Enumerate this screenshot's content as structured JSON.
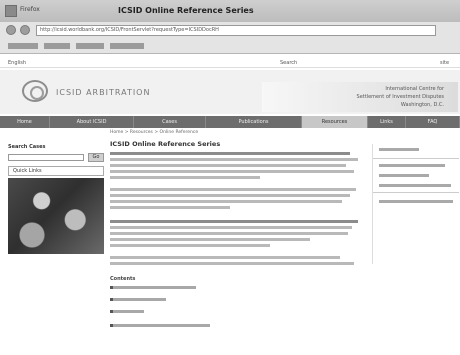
{
  "browser": {
    "window_title": "ICSID Online Reference Series",
    "app_name": "Firefox",
    "url": "http://icsid.worldbank.org/ICSID/FrontServlet?requestType=ICSIDDocRH",
    "bookmark_count": 4
  },
  "page": {
    "top_left": "English",
    "top_right": "Search",
    "top_far": "site",
    "logo_text": "ICSID ARBITRATION",
    "banner_lines": [
      "International Centre for",
      "Settlement of Investment Disputes",
      "Washington, D.C."
    ]
  },
  "navbar": {
    "items": [
      "Home",
      "About ICSID",
      "Cases",
      "Publications",
      "Resources",
      "Links",
      "FAQ"
    ],
    "active_index": 4
  },
  "sidebar": {
    "label": "Search Cases",
    "button": "Go",
    "box_label": "Quick Links"
  },
  "main": {
    "breadcrumb": "Home > Resources > Online Reference",
    "title": "ICSID Online Reference Series",
    "subhead": "Contents"
  },
  "rightbar": {
    "item_count": 5
  },
  "icons": {
    "app": "browser-app-icon",
    "back": "back-arrow-icon",
    "forward": "forward-arrow-icon",
    "logo": "icsid-logo-icon"
  },
  "colors": {
    "navbar": "#6d6d6d",
    "navbar_active": "#c7c7c7",
    "chrome": "#e4e4e4"
  }
}
